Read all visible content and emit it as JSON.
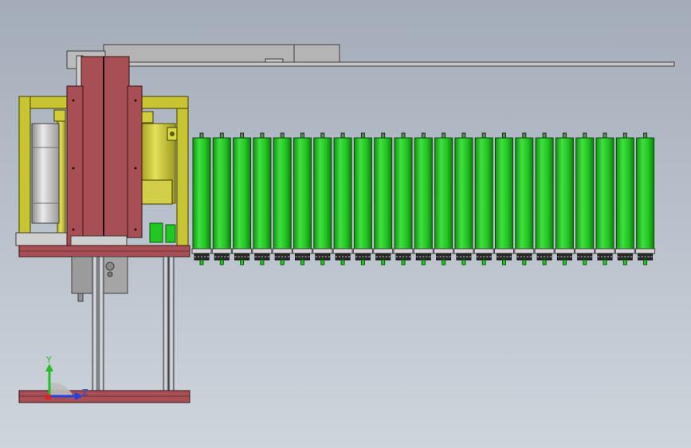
{
  "viewport": {
    "background_top": "#a3acb8",
    "background_bottom": "#cfd5dc"
  },
  "triad": {
    "y_label": "Y",
    "z_label": "Z",
    "y_color": "#22c022",
    "z_color": "#2040e0",
    "x_color": "#e02020"
  },
  "model": {
    "roller_count": 23,
    "colors": {
      "frame_red": "#a84e55",
      "frame_yellow": "#c8c434",
      "roller_green": "#22c822",
      "motor_gray": "#b5b5b5",
      "arm_gray": "#b0b0b0"
    }
  }
}
